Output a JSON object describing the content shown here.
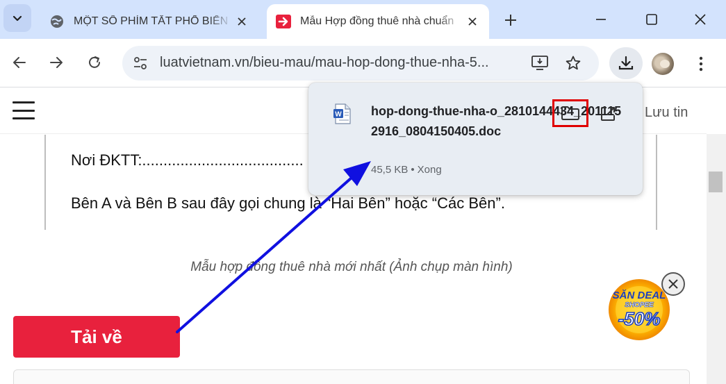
{
  "browser": {
    "tabs": [
      {
        "title": "MỘT SỐ PHÍM TẮT PHỔ BIẾN",
        "active": false,
        "favicon": "globe-icon"
      },
      {
        "title": "Mẫu Hợp đồng thuê nhà chuẩn",
        "active": true,
        "favicon": "luatvietnam-favicon"
      }
    ],
    "url": "luatvietnam.vn/bieu-mau/mau-hop-dong-thue-nha-5..."
  },
  "downloads": {
    "filename": "hop-dong-thue-nha-o_2810144434_2011152916_0804150405.doc",
    "size": "45,5 KB",
    "status": "Xong",
    "highlight_color": "#e00000"
  },
  "page": {
    "save_label": "Lưu tin",
    "doc_line_1": "Nơi ĐKTT:......................................",
    "doc_line_2": "Bên A và Bên B sau đây gọi chung là “Hai Bên” hoặc “Các Bên”.",
    "caption": "Mẫu hợp đồng thuê nhà mới nhất (Ảnh chụp màn hình)",
    "download_button": "Tải về",
    "download_button_color": "#e8213d",
    "promo": {
      "line1": "SĂN DEAL",
      "line2": "SHOPEE",
      "line3": "-50%"
    }
  },
  "annotation": {
    "arrow_color": "#1010e0"
  }
}
